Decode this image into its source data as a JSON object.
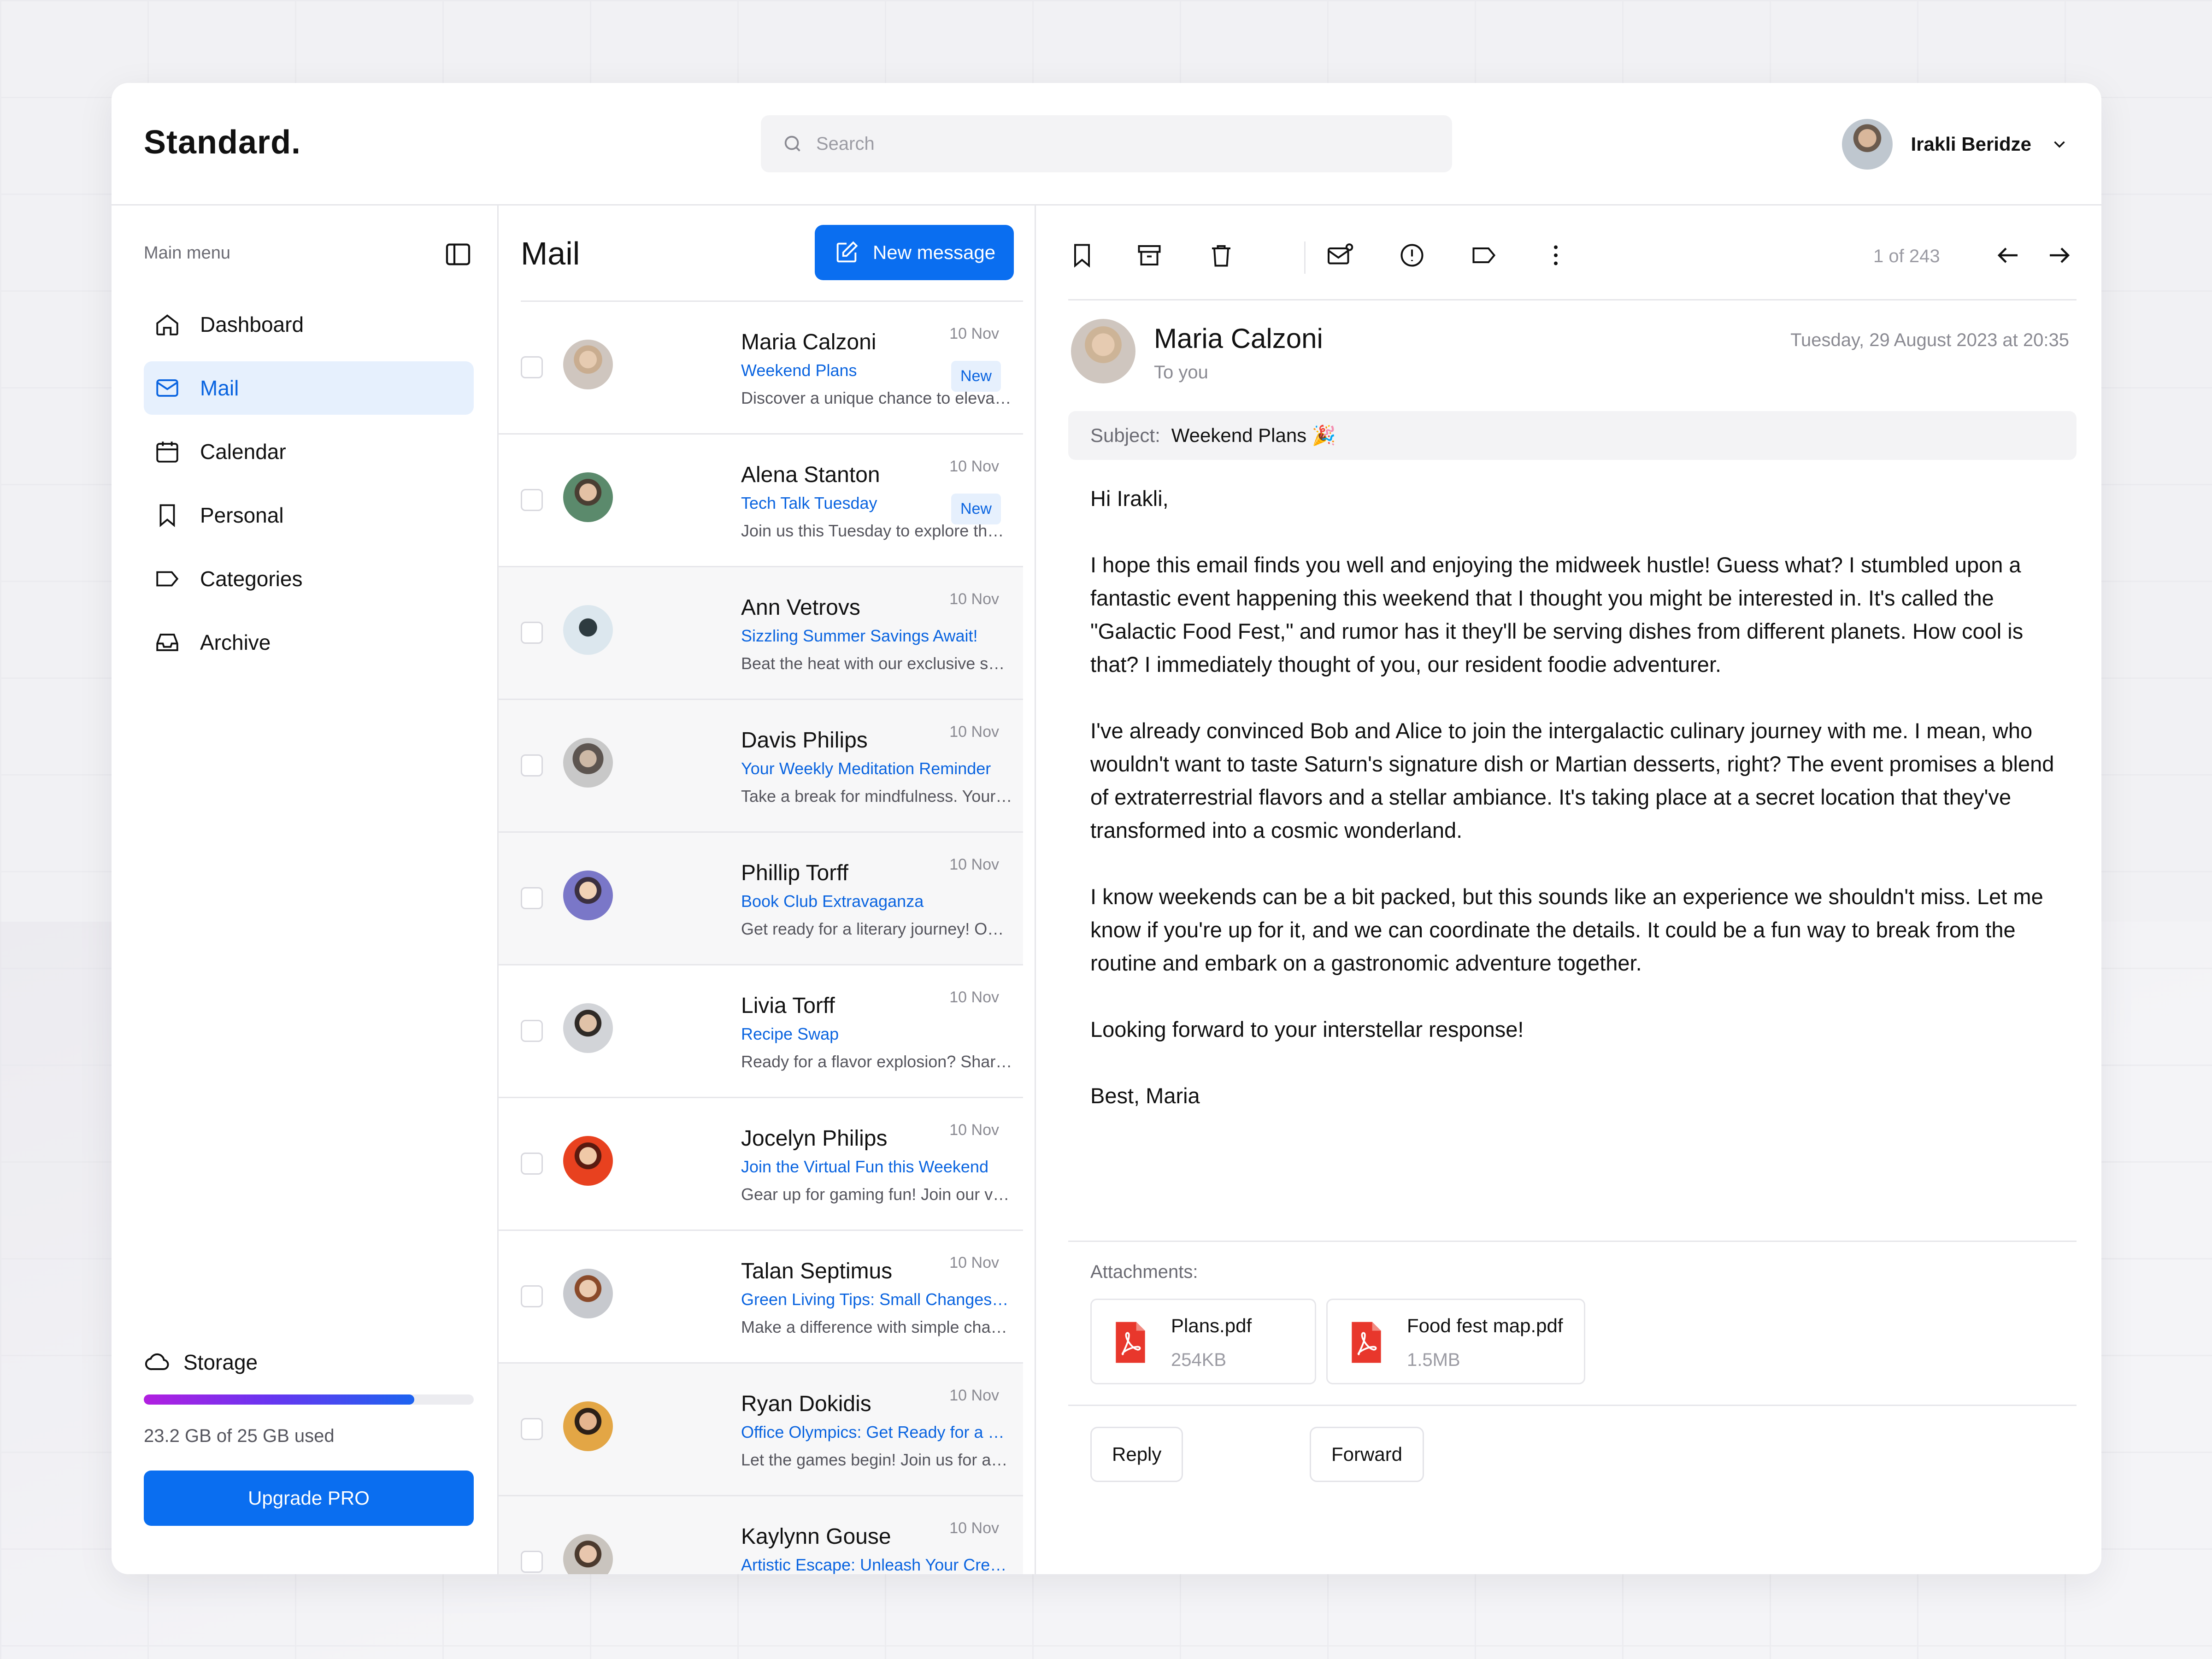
{
  "header": {
    "logo": "Standard.",
    "search_placeholder": "Search",
    "user_name": "Irakli Beridze"
  },
  "sidebar": {
    "title": "Main menu",
    "items": [
      {
        "label": "Dashboard",
        "icon": "home-icon"
      },
      {
        "label": "Mail",
        "icon": "mail-icon",
        "active": true
      },
      {
        "label": "Calendar",
        "icon": "calendar-icon"
      },
      {
        "label": "Personal",
        "icon": "bookmark-icon"
      },
      {
        "label": "Categories",
        "icon": "tag-icon"
      },
      {
        "label": "Archive",
        "icon": "inbox-icon"
      }
    ],
    "storage": {
      "label": "Storage",
      "used_text": "23.2 GB of 25 GB used",
      "used_fraction": 0.82,
      "upgrade_label": "Upgrade PRO"
    }
  },
  "mail_list": {
    "title": "Mail",
    "new_message_label": "New message",
    "items": [
      {
        "name": "Maria Calzoni",
        "subject": "Weekend Plans",
        "preview": "Discover a unique chance to eleva…",
        "date": "10 Nov",
        "badge": "New",
        "read": false
      },
      {
        "name": "Alena Stanton",
        "subject": "Tech Talk Tuesday",
        "preview": "Join us this Tuesday to explore the…",
        "date": "10 Nov",
        "badge": "New",
        "read": false
      },
      {
        "name": "Ann Vetrovs",
        "subject": "Sizzling Summer Savings Await!",
        "preview": "Beat the heat with our exclusive su…",
        "date": "10 Nov",
        "badge": "",
        "read": true
      },
      {
        "name": "Davis Philips",
        "subject": "Your Weekly Meditation Reminder",
        "preview": "Take a break for mindfulness. Your…",
        "date": "10 Nov",
        "badge": "",
        "read": true
      },
      {
        "name": "Phillip Torff",
        "subject": "Book Club Extravaganza",
        "preview": "Get ready for a literary journey! Ou…",
        "date": "10 Nov",
        "badge": "",
        "read": true
      },
      {
        "name": "Livia Torff",
        "subject": "Recipe Swap",
        "preview": "Ready for a flavor explosion? Shar…",
        "date": "10 Nov",
        "badge": "",
        "read": false
      },
      {
        "name": "Jocelyn Philips",
        "subject": "Join the Virtual Fun this Weekend",
        "preview": "Gear up for gaming fun! Join our vi…",
        "date": "10 Nov",
        "badge": "",
        "read": false
      },
      {
        "name": "Talan Septimus",
        "subject": "Green Living Tips: Small Changes,…",
        "preview": "Make a difference with simple cha…",
        "date": "10 Nov",
        "badge": "",
        "read": false
      },
      {
        "name": "Ryan Dokidis",
        "subject": "Office Olympics: Get Ready for a F…",
        "preview": "Let the games begin! Join us for a…",
        "date": "10 Nov",
        "badge": "",
        "read": true
      },
      {
        "name": "Kaylynn Gouse",
        "subject": "Artistic Escape: Unleash Your Crea…",
        "preview": "",
        "date": "10 Nov",
        "badge": "",
        "read": true
      }
    ]
  },
  "reader": {
    "pager": "1 of 243",
    "sender": "Maria Calzoni",
    "to": "To you",
    "date": "Tuesday, 29 August 2023 at 20:35",
    "subject_label": "Subject:",
    "subject": "Weekend Plans 🎉",
    "body": [
      "Hi Irakli,",
      "I hope this email finds you well and enjoying the midweek hustle! Guess what? I stumbled upon a fantastic event happening this weekend that I thought you might be interested in. It's called the \"Galactic Food Fest,\" and rumor has it they'll be serving dishes from different planets. How cool is that? I immediately thought of you, our resident foodie adventurer.",
      "I've already convinced Bob and Alice to join the intergalactic culinary journey with me. I mean, who wouldn't want to taste Saturn's signature dish or Martian desserts, right? The event promises a blend of extraterrestrial flavors and a stellar ambiance. It's taking place at a secret location that they've transformed into a cosmic wonderland.",
      "I know weekends can be a bit packed, but this sounds like an experience we shouldn't miss. Let me know if you're up for it, and we can coordinate the details. It could be a fun way to break from the routine and embark on a gastronomic adventure together.",
      "Looking forward to your interstellar response!",
      "Best, Maria"
    ],
    "attachments_label": "Attachments:",
    "attachments": [
      {
        "name": "Plans.pdf",
        "size": "254KB"
      },
      {
        "name": "Food fest map.pdf",
        "size": "1.5MB"
      }
    ],
    "reply_label": "Reply",
    "forward_label": "Forward"
  },
  "colors": {
    "accent": "#0a6ef0",
    "link": "#0a64e0",
    "active_bg": "#e6f0fd",
    "pdf_red": "#e8372c"
  }
}
